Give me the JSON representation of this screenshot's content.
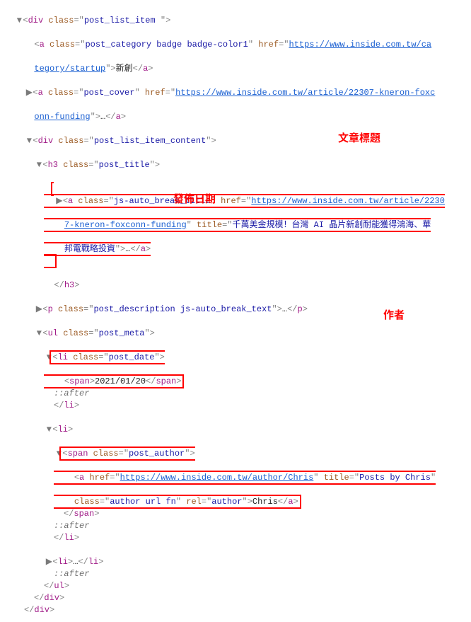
{
  "labels": {
    "title": "文章標題",
    "date": "發佈日期",
    "author": "作者"
  },
  "tree": {
    "t1": "div",
    "a1_n": "class",
    "a1_v": "post_list_item ",
    "t2": "a",
    "a2_n": "class",
    "a2_v": "post_category badge badge-color1",
    "a2h_n": "href",
    "a2h_v1": "https://www.inside.com.tw/ca",
    "a2h_v2": "tegory/startup",
    "txt2": "新創",
    "t3": "a",
    "a3_n": "class",
    "a3_v": "post_cover",
    "a3h_n": "href",
    "a3h_v1": "https://www.inside.com.tw/article/22307-kneron-foxc",
    "a3h_v2": "onn-funding",
    "t3e": "…",
    "t4": "div",
    "a4_n": "class",
    "a4_v": "post_list_item_content",
    "t5": "h3",
    "a5_n": "class",
    "a5_v": "post_title",
    "t6": "a",
    "a6_n": "class",
    "a6_v": "js-auto_break_title",
    "a6h_n": "href",
    "a6h_v1": "https://www.inside.com.tw/article/2230",
    "a6h_v2": "7-kneron-foxconn-funding",
    "a6t_n": "title",
    "a6t_v1": "千萬美金規模！台灣 AI 晶片新創耐能獲得鴻海、華",
    "a6t_v2": "邦電戰略投資",
    "t6e": "…",
    "close_h3": "h3",
    "t7": "p",
    "a7_n": "class",
    "a7_v": "post_description js-auto_break_text",
    "t7e": "…",
    "t8": "ul",
    "a8_n": "class",
    "a8_v": "post_meta",
    "t9": "li",
    "a9_n": "class",
    "a9_v": "post_date",
    "t10": "span",
    "txt10": "2021/01/20",
    "pseudo": "::after",
    "close_li": "li",
    "t11": "li",
    "t12": "span",
    "a12_n": "class",
    "a12_v": "post_author",
    "t13": "a",
    "a13h_n": "href",
    "a13h_v": "https://www.inside.com.tw/author/Chris",
    "a13t_n": "title",
    "a13t_v": "Posts by Chris",
    "a13c_n": "class",
    "a13c_v": "author url fn",
    "a13r_n": "rel",
    "a13r_v": "author",
    "txt13": "Chris",
    "close_span": "span",
    "close_ul": "ul",
    "close_div": "div",
    "t14": "li",
    "t14e": "…"
  }
}
